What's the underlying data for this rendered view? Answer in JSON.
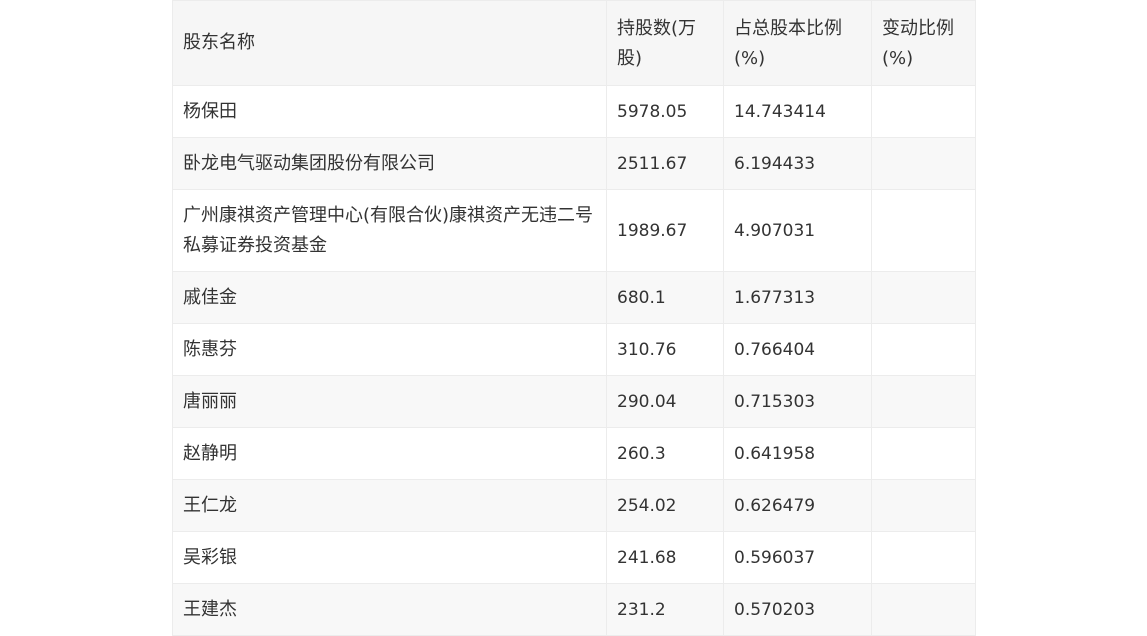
{
  "table": {
    "headers": [
      "股东名称",
      "持股数(万股)",
      "占总股本比例(%)",
      "变动比例(%)"
    ],
    "header_lines": {
      "shares": [
        "持股数(万",
        "股)"
      ],
      "ratio": [
        "占总股本比例",
        "(%)"
      ],
      "change": [
        "变动比例",
        "(%)"
      ]
    },
    "rows": [
      {
        "name": "杨保田",
        "shares": "5978.05",
        "ratio": "14.743414",
        "change": ""
      },
      {
        "name": "卧龙电气驱动集团股份有限公司",
        "shares": "2511.67",
        "ratio": "6.194433",
        "change": ""
      },
      {
        "name": "广州康祺资产管理中心(有限合伙)康祺资产无违二号私募证券投资基金",
        "shares": "1989.67",
        "ratio": "4.907031",
        "change": ""
      },
      {
        "name": "戚佳金",
        "shares": "680.1",
        "ratio": "1.677313",
        "change": ""
      },
      {
        "name": "陈惠芬",
        "shares": "310.76",
        "ratio": "0.766404",
        "change": ""
      },
      {
        "name": "唐丽丽",
        "shares": "290.04",
        "ratio": "0.715303",
        "change": ""
      },
      {
        "name": "赵静明",
        "shares": "260.3",
        "ratio": "0.641958",
        "change": ""
      },
      {
        "name": "王仁龙",
        "shares": "254.02",
        "ratio": "0.626479",
        "change": ""
      },
      {
        "name": "吴彩银",
        "shares": "241.68",
        "ratio": "0.596037",
        "change": ""
      },
      {
        "name": "王建杰",
        "shares": "231.2",
        "ratio": "0.570203",
        "change": ""
      }
    ]
  }
}
